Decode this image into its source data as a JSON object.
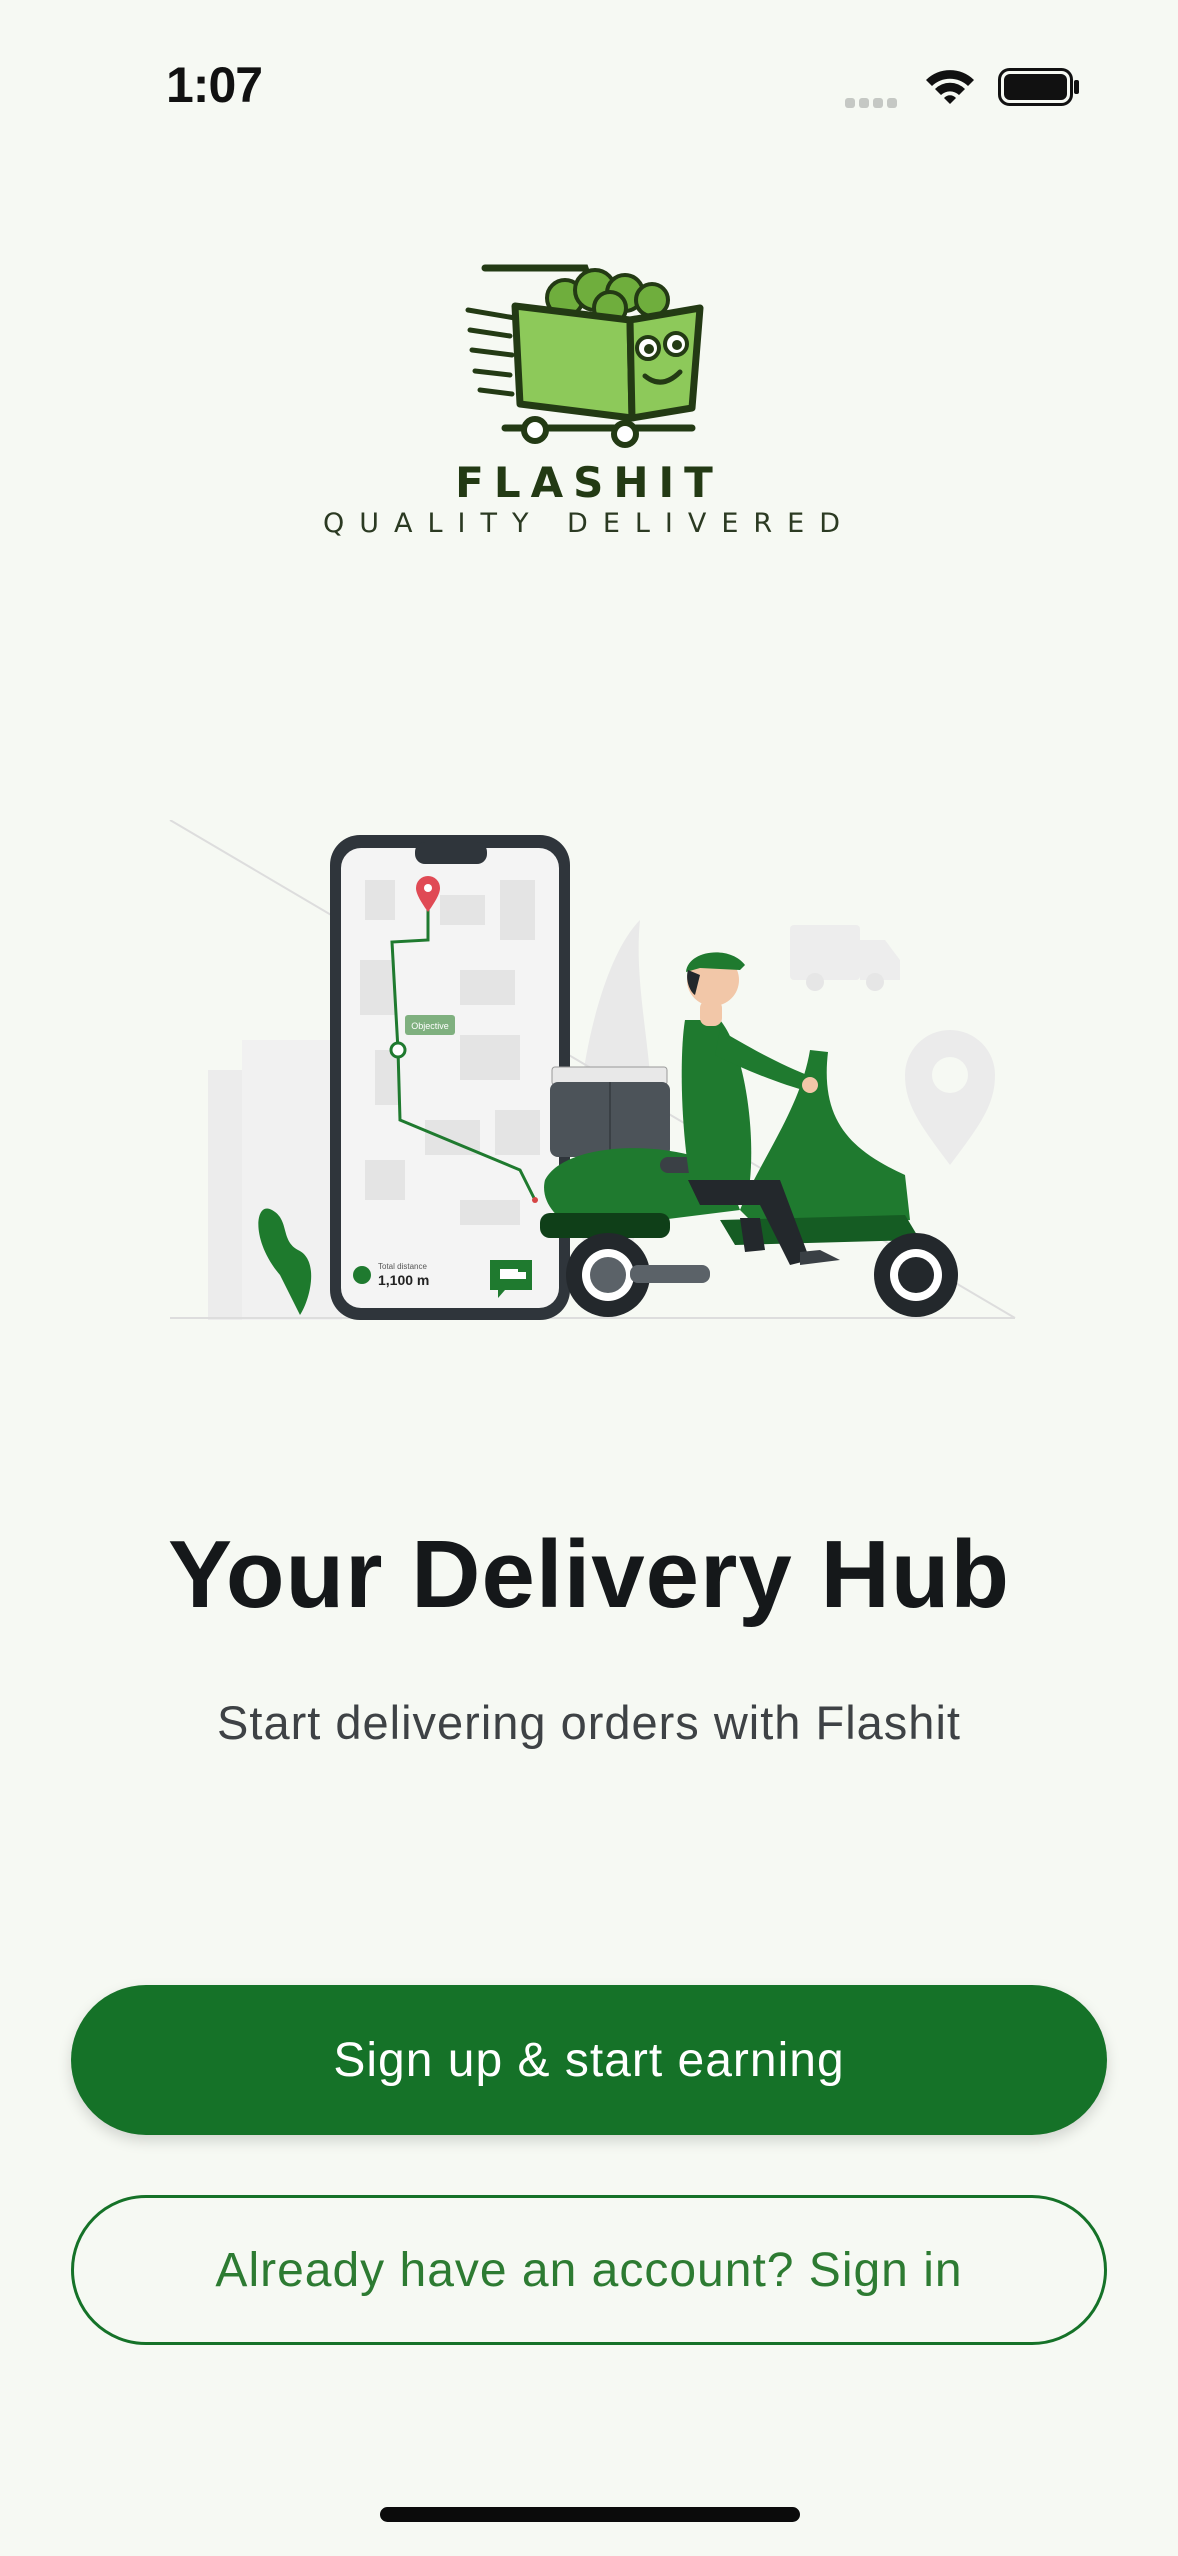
{
  "status_bar": {
    "time": "1:07",
    "icons": [
      "cellular-icon",
      "wifi-icon",
      "battery-icon"
    ]
  },
  "brand": {
    "name": "FLASHIT",
    "tagline": "QUALITY DELIVERED",
    "colors": {
      "primary": "#157228",
      "logo_green": "#8dc95a",
      "dark": "#233a14"
    }
  },
  "illustration": {
    "map_label": "Objective",
    "distance_label": "Total distance",
    "distance_value": "1,100 m"
  },
  "hero": {
    "title": "Your Delivery Hub",
    "subtitle": "Start delivering orders with Flashit"
  },
  "actions": {
    "signup_label": "Sign up & start earning",
    "signin_label": "Already have an account? Sign in"
  }
}
